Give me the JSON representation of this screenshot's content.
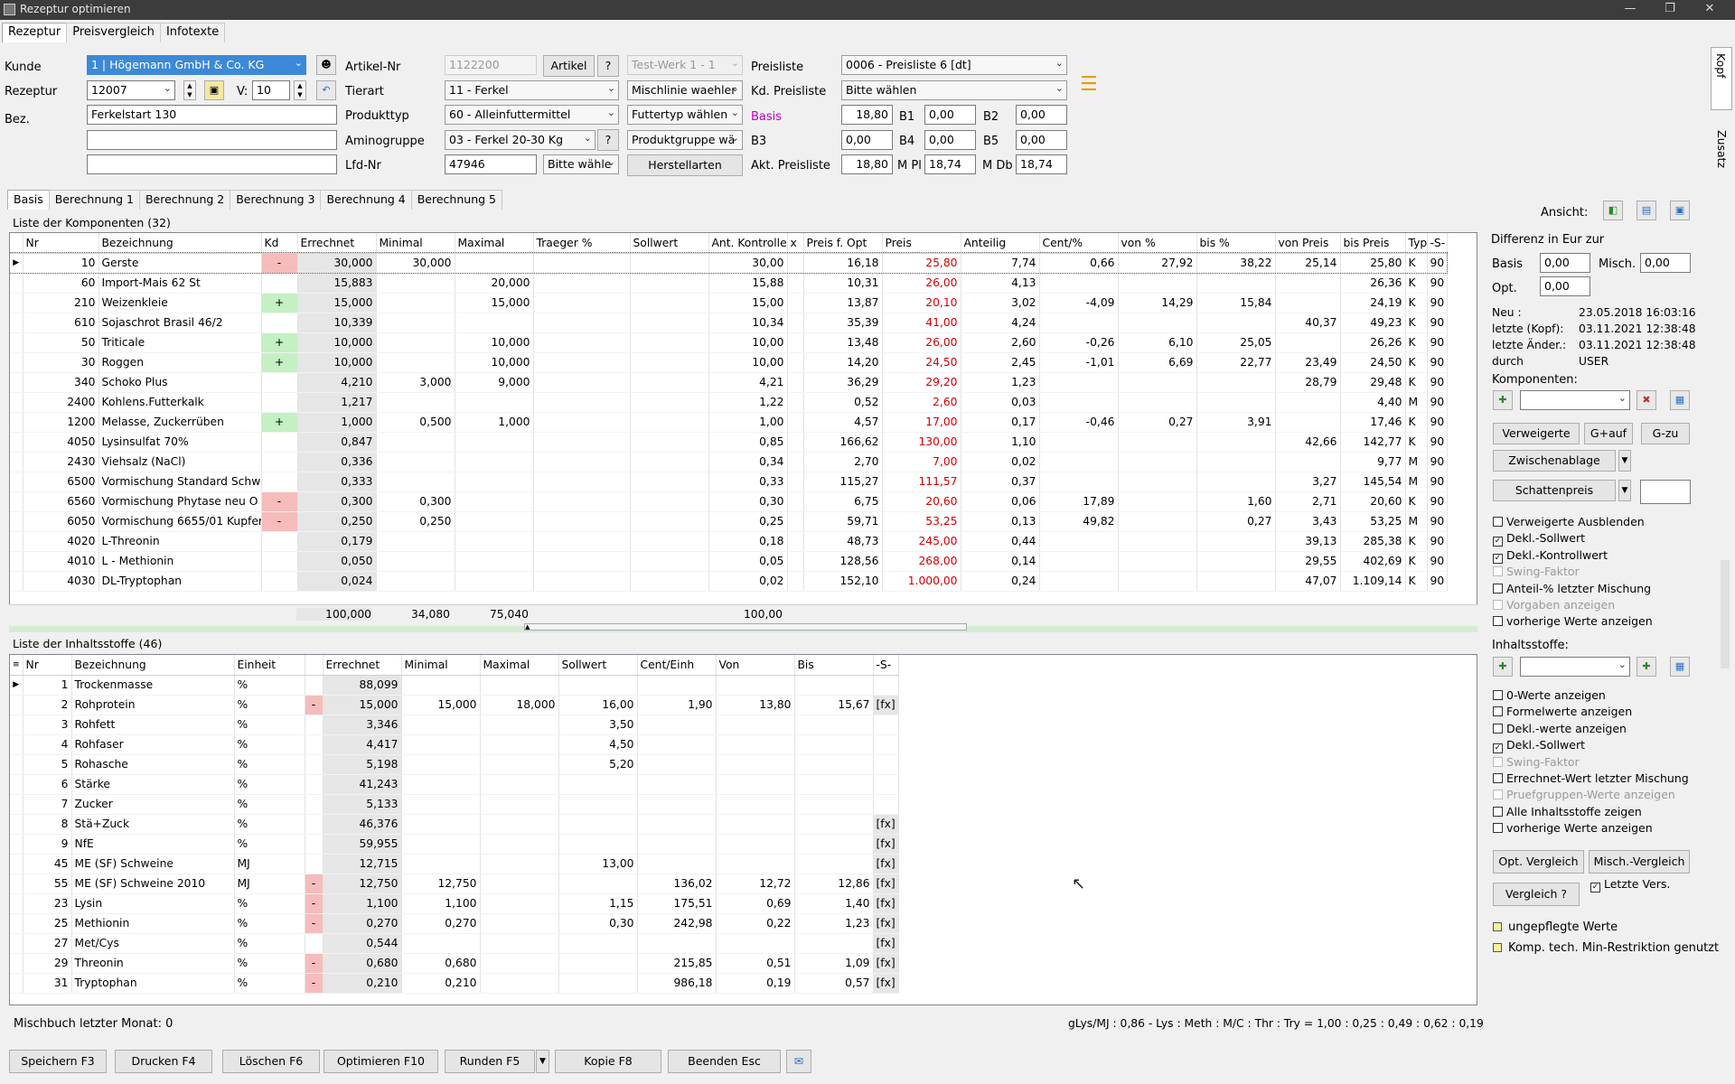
{
  "window": {
    "title": "Rezeptur optimieren"
  },
  "top_tabs": [
    "Rezeptur",
    "Preisvergleich",
    "Infotexte"
  ],
  "header": {
    "kunde_label": "Kunde",
    "kunde_value": "1 | Högemann GmbH & Co. KG",
    "rezeptur_label": "Rezeptur",
    "rezeptur_value": "12007",
    "v_label": "V:",
    "v_value": "10",
    "bez_label": "Bez.",
    "bez_value": "Ferkelstart 130",
    "artikel_nr_label": "Artikel-Nr",
    "artikel_nr_value": "1122200",
    "artikel_button": "Artikel",
    "help_button": "?",
    "tierart_label": "Tierart",
    "tierart_value": "11 - Ferkel",
    "produkttyp_label": "Produkttyp",
    "produkttyp_value": "60 - Alleinfuttermittel",
    "aminogruppe_label": "Aminogruppe",
    "aminogruppe_value": "03 - Ferkel 20-30 Kg",
    "lfd_nr_label": "Lfd-Nr",
    "lfd_nr_value": "47946",
    "bitte_waehle": "Bitte wähle",
    "werk_value": "Test-Werk 1 - 1",
    "mischlinie": "Mischlinie waehler",
    "futtertyp": "Futtertyp wählen",
    "produktgruppe": "Produktgruppe wä",
    "herstellarten_button": "Herstellarten",
    "preisliste_label": "Preisliste",
    "preisliste_value": "0006 - Preisliste 6 [dt]",
    "kd_preisliste_label": "Kd. Preisliste",
    "kd_preisliste_value": "Bitte wählen",
    "basis_label": "Basis",
    "basis_value": "18,80",
    "b1_label": "B1",
    "b1_value": "0,00",
    "b2_label": "B2",
    "b2_value": "0,00",
    "b3_label": "B3",
    "b3_value": "0,00",
    "b4_label": "B4",
    "b4_value": "0,00",
    "b5_label": "B5",
    "b5_value": "0,00",
    "akt_preisliste_label": "Akt. Preisliste",
    "akt_preisliste_value": "18,80",
    "m_pl_label": "M Pl",
    "m_pl_value": "18,74",
    "m_db_label": "M Db",
    "m_db_value": "18,74",
    "basis_color": "#c000c0"
  },
  "side_tabs": [
    "Kopf",
    "Zusatz"
  ],
  "calc_tabs": [
    "Basis",
    "Berechnung 1",
    "Berechnung 2",
    "Berechnung 3",
    "Berechnung 4",
    "Berechnung 5"
  ],
  "components": {
    "title": "Liste der Komponenten (32)",
    "columns": [
      "Nr",
      "Bezeichnung",
      "Kd",
      "Errechnet",
      "Minimal",
      "Maximal",
      "Traeger %",
      "Sollwert",
      "Ant. Kontrolle",
      "x",
      "Preis f. Opt",
      "Preis",
      "Anteilig",
      "Cent/%",
      "von %",
      "bis %",
      "von Preis",
      "bis Preis",
      "Typ",
      "-S-"
    ],
    "rows": [
      [
        "10",
        "Gerste",
        "-",
        "30,000",
        "30,000",
        "",
        "",
        "",
        "30,00",
        "",
        "16,18",
        "25,80",
        "7,74",
        "0,66",
        "27,92",
        "38,22",
        "25,14",
        "25,80",
        "K",
        "90"
      ],
      [
        "60",
        "Import-Mais 62 St",
        "",
        "15,883",
        "",
        "20,000",
        "",
        "",
        "15,88",
        "",
        "10,31",
        "26,00",
        "4,13",
        "",
        "",
        "",
        "",
        "26,36",
        "K",
        "90"
      ],
      [
        "210",
        "Weizenkleie",
        "+",
        "15,000",
        "",
        "15,000",
        "",
        "",
        "15,00",
        "",
        "13,87",
        "20,10",
        "3,02",
        "-4,09",
        "14,29",
        "15,84",
        "",
        "24,19",
        "K",
        "90"
      ],
      [
        "610",
        "Sojaschrot Brasil 46/2",
        "",
        "10,339",
        "",
        "",
        "",
        "",
        "10,34",
        "",
        "35,39",
        "41,00",
        "4,24",
        "",
        "",
        "",
        "40,37",
        "49,23",
        "K",
        "90"
      ],
      [
        "50",
        "Triticale",
        "+",
        "10,000",
        "",
        "10,000",
        "",
        "",
        "10,00",
        "",
        "13,48",
        "26,00",
        "2,60",
        "-0,26",
        "6,10",
        "25,05",
        "",
        "26,26",
        "K",
        "90"
      ],
      [
        "30",
        "Roggen",
        "+",
        "10,000",
        "",
        "10,000",
        "",
        "",
        "10,00",
        "",
        "14,20",
        "24,50",
        "2,45",
        "-1,01",
        "6,69",
        "22,77",
        "23,49",
        "24,50",
        "K",
        "90"
      ],
      [
        "340",
        "Schoko Plus",
        "",
        "4,210",
        "3,000",
        "9,000",
        "",
        "",
        "4,21",
        "",
        "36,29",
        "29,20",
        "1,23",
        "",
        "",
        "",
        "28,79",
        "29,48",
        "K",
        "90"
      ],
      [
        "2400",
        "Kohlens.Futterkalk",
        "",
        "1,217",
        "",
        "",
        "",
        "",
        "1,22",
        "",
        "0,52",
        "2,60",
        "0,03",
        "",
        "",
        "",
        "",
        "4,40",
        "M",
        "90"
      ],
      [
        "1200",
        "Melasse, Zuckerrüben",
        "+",
        "1,000",
        "0,500",
        "1,000",
        "",
        "",
        "1,00",
        "",
        "4,57",
        "17,00",
        "0,17",
        "-0,46",
        "0,27",
        "3,91",
        "",
        "17,46",
        "K",
        "90"
      ],
      [
        "4050",
        "Lysinsulfat 70%",
        "",
        "0,847",
        "",
        "",
        "",
        "",
        "0,85",
        "",
        "166,62",
        "130,00",
        "1,10",
        "",
        "",
        "",
        "42,66",
        "142,77",
        "K",
        "90"
      ],
      [
        "2430",
        "Viehsalz (NaCl)",
        "",
        "0,336",
        "",
        "",
        "",
        "",
        "0,34",
        "",
        "2,70",
        "7,00",
        "0,02",
        "",
        "",
        "",
        "",
        "9,77",
        "M",
        "90"
      ],
      [
        "6500",
        "Vormischung Standard Schwe",
        "",
        "0,333",
        "",
        "",
        "",
        "",
        "0,33",
        "",
        "115,27",
        "111,57",
        "0,37",
        "",
        "",
        "",
        "3,27",
        "145,54",
        "M",
        "90"
      ],
      [
        "6560",
        "Vormischung Phytase neu O +",
        "-",
        "0,300",
        "0,300",
        "",
        "",
        "",
        "0,30",
        "",
        "6,75",
        "20,60",
        "0,06",
        "17,89",
        "",
        "1,60",
        "2,71",
        "20,60",
        "K",
        "90"
      ],
      [
        "6050",
        "Vormischung 6655/01 Kupfer",
        "-",
        "0,250",
        "0,250",
        "",
        "",
        "",
        "0,25",
        "",
        "59,71",
        "53,25",
        "0,13",
        "49,82",
        "",
        "0,27",
        "3,43",
        "53,25",
        "M",
        "90"
      ],
      [
        "4020",
        "L-Threonin",
        "",
        "0,179",
        "",
        "",
        "",
        "",
        "0,18",
        "",
        "48,73",
        "245,00",
        "0,44",
        "",
        "",
        "",
        "39,13",
        "285,38",
        "K",
        "90"
      ],
      [
        "4010",
        "L - Methionin",
        "",
        "0,050",
        "",
        "",
        "",
        "",
        "0,05",
        "",
        "128,56",
        "268,00",
        "0,14",
        "",
        "",
        "",
        "29,55",
        "402,69",
        "K",
        "90"
      ],
      [
        "4030",
        "DL-Tryptophan",
        "",
        "0,024",
        "",
        "",
        "",
        "",
        "0,02",
        "",
        "152,10",
        "1.000,00",
        "0,24",
        "",
        "",
        "",
        "47,07",
        "1.109,14",
        "K",
        "90"
      ]
    ],
    "totals": {
      "errechnet": "100,000",
      "minimal": "34,080",
      "maximal": "75,040",
      "ant_kontrolle": "100,00"
    }
  },
  "ingredients": {
    "title": "Liste der Inhaltsstoffe (46)",
    "columns": [
      "Nr",
      "Bezeichnung",
      "Einheit",
      "",
      "Errechnet",
      "Minimal",
      "Maximal",
      "Sollwert",
      "Cent/Einh",
      "Von",
      "Bis",
      "-S-"
    ],
    "rows": [
      [
        "1",
        "Trockenmasse",
        "%",
        "",
        "88,099",
        "",
        "",
        "",
        "",
        "",
        "",
        ""
      ],
      [
        "2",
        "Rohprotein",
        "%",
        "-",
        "15,000",
        "15,000",
        "18,000",
        "16,00",
        "1,90",
        "13,80",
        "15,67",
        "[fx]"
      ],
      [
        "3",
        "Rohfett",
        "%",
        "",
        "3,346",
        "",
        "",
        "3,50",
        "",
        "",
        "",
        ""
      ],
      [
        "4",
        "Rohfaser",
        "%",
        "",
        "4,417",
        "",
        "",
        "4,50",
        "",
        "",
        "",
        ""
      ],
      [
        "5",
        "Rohasche",
        "%",
        "",
        "5,198",
        "",
        "",
        "5,20",
        "",
        "",
        "",
        ""
      ],
      [
        "6",
        "Stärke",
        "%",
        "",
        "41,243",
        "",
        "",
        "",
        "",
        "",
        "",
        ""
      ],
      [
        "7",
        "Zucker",
        "%",
        "",
        "5,133",
        "",
        "",
        "",
        "",
        "",
        "",
        ""
      ],
      [
        "8",
        "Stä+Zuck",
        "%",
        "",
        "46,376",
        "",
        "",
        "",
        "",
        "",
        "",
        "[fx]"
      ],
      [
        "9",
        "NfE",
        "%",
        "",
        "59,955",
        "",
        "",
        "",
        "",
        "",
        "",
        "[fx]"
      ],
      [
        "45",
        "ME (SF) Schweine",
        "MJ",
        "",
        "12,715",
        "",
        "",
        "13,00",
        "",
        "",
        "",
        "[fx]"
      ],
      [
        "55",
        "ME (SF) Schweine 2010",
        "MJ",
        "-",
        "12,750",
        "12,750",
        "",
        "",
        "136,02",
        "12,72",
        "12,86",
        "[fx]"
      ],
      [
        "23",
        "Lysin",
        "%",
        "-",
        "1,100",
        "1,100",
        "",
        "1,15",
        "175,51",
        "0,69",
        "1,40",
        "[fx]"
      ],
      [
        "25",
        "Methionin",
        "%",
        "-",
        "0,270",
        "0,270",
        "",
        "0,30",
        "242,98",
        "0,22",
        "1,23",
        "[fx]"
      ],
      [
        "27",
        "Met/Cys",
        "%",
        "",
        "0,544",
        "",
        "",
        "",
        "",
        "",
        "",
        "[fx]"
      ],
      [
        "29",
        "Threonin",
        "%",
        "-",
        "0,680",
        "0,680",
        "",
        "",
        "215,85",
        "0,51",
        "1,09",
        "[fx]"
      ],
      [
        "31",
        "Tryptophan",
        "%",
        "-",
        "0,210",
        "0,210",
        "",
        "",
        "986,18",
        "0,19",
        "0,57",
        "[fx]"
      ]
    ]
  },
  "status": {
    "left": "Mischbuch letzter Monat: 0",
    "right": "gLys/MJ : 0,86  - Lys : Meth : M/C : Thr : Try = 1,00 : 0,25 : 0,49 : 0,62 : 0,19"
  },
  "right_panel": {
    "ansicht": "Ansicht:",
    "differenz": "Differenz in Eur zur",
    "basis_label": "Basis",
    "basis_value": "0,00",
    "misch_label": "Misch.",
    "misch_value": "0,00",
    "opt_label": "Opt.",
    "opt_value": "0,00",
    "neu_label": "Neu :",
    "neu_value": "23.05.2018 16:03:16",
    "letzte_kopf_label": "letzte (Kopf):",
    "letzte_kopf_value": "03.11.2021 12:38:48",
    "letzte_aender_label": "letzte Änder.:",
    "letzte_aender_value": "03.11.2021 12:38:48",
    "durch_label": "durch",
    "durch_value": "USER",
    "komponenten_label": "Komponenten:",
    "verweigerte": "Verweigerte",
    "g_auf": "G+auf",
    "g_zu": "G-zu",
    "zwischenablage": "Zwischenablage",
    "schattenpreis": "Schattenpreis",
    "comp_checks": [
      {
        "label": "Verweigerte Ausblenden",
        "checked": false,
        "disabled": false
      },
      {
        "label": "Dekl.-Sollwert",
        "checked": true,
        "disabled": false
      },
      {
        "label": "Dekl.-Kontrollwert",
        "checked": true,
        "disabled": false
      },
      {
        "label": "Swing-Faktor",
        "checked": false,
        "disabled": true
      },
      {
        "label": "Anteil-% letzter Mischung",
        "checked": false,
        "disabled": false
      },
      {
        "label": "Vorgaben anzeigen",
        "checked": false,
        "disabled": true
      },
      {
        "label": "vorherige Werte anzeigen",
        "checked": false,
        "disabled": false
      }
    ],
    "inhaltsstoffe_label": "Inhaltsstoffe:",
    "ing_checks": [
      {
        "label": "0-Werte anzeigen",
        "checked": false,
        "disabled": false
      },
      {
        "label": "Formelwerte anzeigen",
        "checked": false,
        "disabled": false
      },
      {
        "label": "Dekl.-werte anzeigen",
        "checked": false,
        "disabled": false
      },
      {
        "label": "Dekl.-Sollwert",
        "checked": true,
        "disabled": false
      },
      {
        "label": "Swing-Faktor",
        "checked": false,
        "disabled": true
      },
      {
        "label": "Errechnet-Wert letzter Mischung",
        "checked": false,
        "disabled": false
      },
      {
        "label": "Pruefgruppen-Werte anzeigen",
        "checked": false,
        "disabled": true
      },
      {
        "label": "Alle Inhaltsstoffe zeigen",
        "checked": false,
        "disabled": false
      },
      {
        "label": "vorherige Werte anzeigen",
        "checked": false,
        "disabled": false
      }
    ],
    "opt_vergleich": "Opt. Vergleich",
    "misch_vergleich": "Misch.-Vergleich",
    "vergleich": "Vergleich ?",
    "letzte_vers": "Letzte Vers.",
    "legend1": "ungepflegte Werte",
    "legend2": "Komp. tech. Min-Restriktion genutzt"
  },
  "bottom_buttons": [
    "Speichern F3",
    "Drucken F4",
    "Löschen F6",
    "Optimieren F10",
    "Runden F5",
    "Kopie F8",
    "Beenden Esc"
  ],
  "colors": {
    "red_price": "#d40000",
    "kd_minus": "#f6bcbc",
    "kd_plus": "#c4f0c4",
    "selection": "#3c89d9"
  }
}
